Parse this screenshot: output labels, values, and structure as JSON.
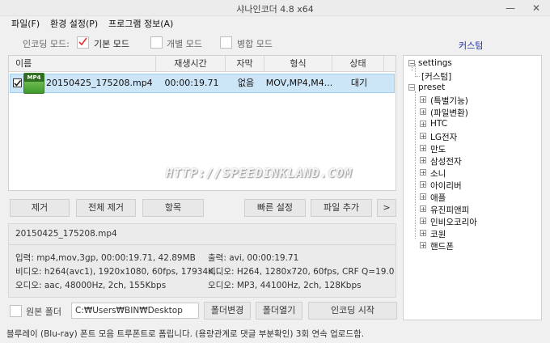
{
  "window": {
    "title": "샤나인코더 4.8 x64",
    "min_glyph": "—",
    "close_glyph": "✕"
  },
  "menu": {
    "items": [
      "파일(F)",
      "환경 설정(P)",
      "프로그램 정보(A)"
    ]
  },
  "encoding_mode": {
    "label": "인코딩 모드:",
    "options": [
      {
        "label": "기본 모드",
        "checked": true
      },
      {
        "label": "개별 모드",
        "checked": false
      },
      {
        "label": "병합 모드",
        "checked": false
      }
    ],
    "custom_link": "커스텀"
  },
  "file_table": {
    "headers": [
      "이름",
      "재생시간",
      "자막",
      "형식",
      "상태"
    ],
    "rows": [
      {
        "checked": true,
        "badge": "MP4",
        "name": "20150425_175208.mp4",
        "duration": "00:00:19.71",
        "subtitle": "없음",
        "format": "MOV,MP4,M4...",
        "status": "대기"
      }
    ]
  },
  "buttons": {
    "remove": "제거",
    "remove_all": "전체 제거",
    "item": "항목",
    "quick_settings": "빠른 설정",
    "add_file": "파일 추가",
    "more": ">",
    "change_folder": "폴더변경",
    "open_folder": "폴더열기",
    "start_encoding": "인코딩 시작"
  },
  "info": {
    "filename": "20150425_175208.mp4",
    "input_line": "입력: mp4,mov,3gp, 00:00:19.71, 42.89MB",
    "input_video": "비디오: h264(avc1), 1920x1080, 60fps, 17934K...",
    "input_audio": "오디오: aac, 48000Hz, 2ch, 155Kbps",
    "output_line": "출력: avi, 00:00:19.71",
    "output_video": "비디오: H264, 1280x720, 60fps, CRF Q=19.0",
    "output_audio": "오디오: MP3, 44100Hz, 2ch, 128Kbps"
  },
  "output_folder": {
    "label": "원본 폴더",
    "path": "C:₩Users₩BIN₩Desktop"
  },
  "tree": {
    "settings": {
      "label": "settings",
      "child": "[커스텀]"
    },
    "preset": {
      "label": "preset",
      "children": [
        "(특별기능)",
        "(파일변환)",
        "HTC",
        "LG전자",
        "만도",
        "삼성전자",
        "소니",
        "아이리버",
        "애플",
        "유진피앤피",
        "인비오코리아",
        "코원",
        "핸드폰"
      ]
    }
  },
  "watermark": "HTTP://SPEEDINKLAND.COM",
  "status_text": "블루레이 (Blu-ray) 폰트 모음 트루폰트로 폼립니다. (용량관계로 댓글 부분확인) 3회 연속 업로드함."
}
